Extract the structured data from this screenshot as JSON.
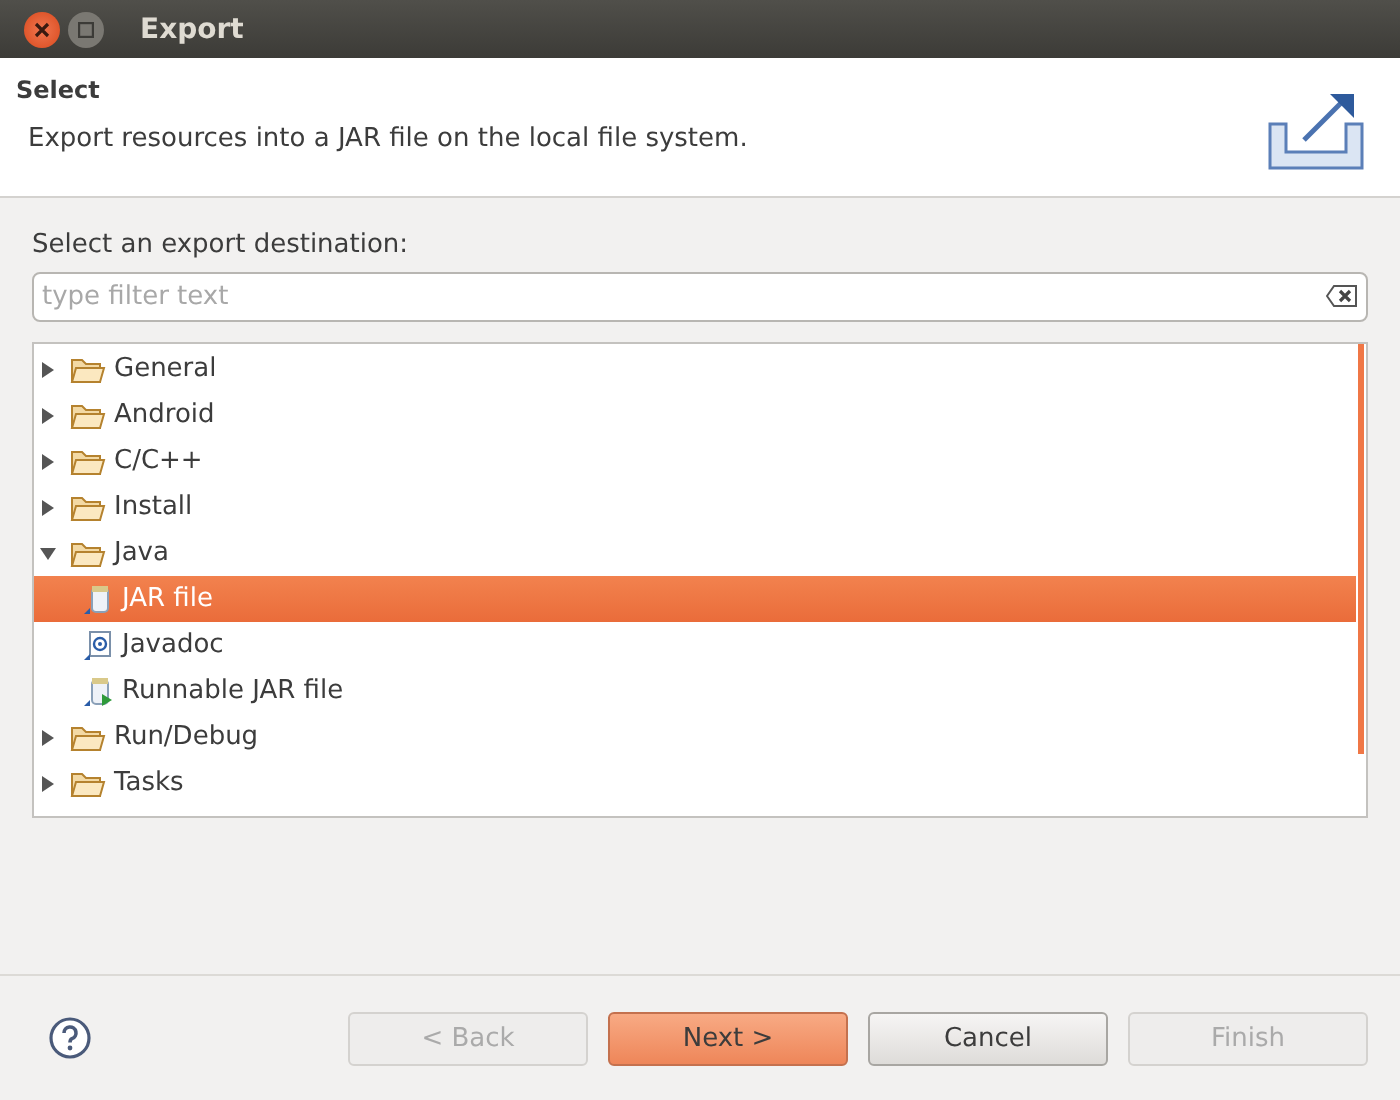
{
  "window": {
    "title": "Export"
  },
  "header": {
    "title": "Select",
    "description": "Export resources into a JAR file on the local file system."
  },
  "destination_label": "Select an export destination:",
  "filter": {
    "placeholder": "type filter text"
  },
  "tree": [
    {
      "label": "General",
      "kind": "folder",
      "expanded": false,
      "selected": false
    },
    {
      "label": "Android",
      "kind": "folder",
      "expanded": false,
      "selected": false
    },
    {
      "label": "C/C++",
      "kind": "folder",
      "expanded": false,
      "selected": false
    },
    {
      "label": "Install",
      "kind": "folder",
      "expanded": false,
      "selected": false
    },
    {
      "label": "Java",
      "kind": "folder",
      "expanded": true,
      "selected": false,
      "children": [
        {
          "label": "JAR file",
          "kind": "jar",
          "selected": true
        },
        {
          "label": "Javadoc",
          "kind": "javadoc",
          "selected": false
        },
        {
          "label": "Runnable JAR file",
          "kind": "runnable",
          "selected": false
        }
      ]
    },
    {
      "label": "Run/Debug",
      "kind": "folder",
      "expanded": false,
      "selected": false
    },
    {
      "label": "Tasks",
      "kind": "folder",
      "expanded": false,
      "selected": false
    }
  ],
  "buttons": [
    {
      "label": "< Back",
      "disabled": true,
      "default": false
    },
    {
      "label": "Next >",
      "disabled": false,
      "default": true
    },
    {
      "label": "Cancel",
      "disabled": false,
      "default": false
    },
    {
      "label": "Finish",
      "disabled": true,
      "default": false
    }
  ]
}
